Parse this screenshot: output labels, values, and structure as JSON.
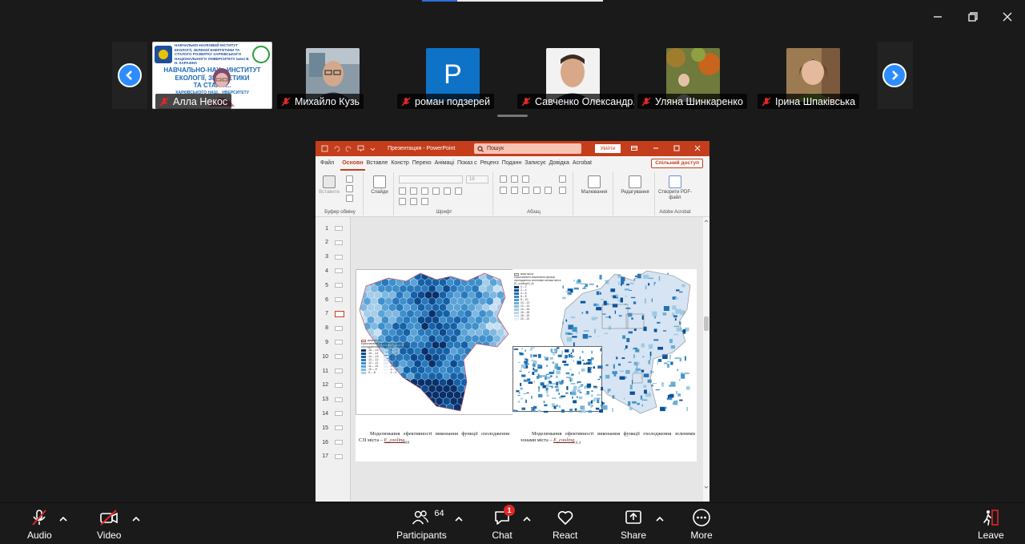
{
  "colors": {
    "accent": "#2d8cff",
    "powerpoint": "#c43e1c",
    "mute": "#e02828",
    "background": "#1a1a1a"
  },
  "participants": [
    {
      "name": "Алла Некос",
      "muted": true,
      "video": "poster"
    },
    {
      "name": "Михайло Кузь",
      "muted": true,
      "video": "photo"
    },
    {
      "name": "роман подзерей",
      "muted": true,
      "video": "letter",
      "letter": "P"
    },
    {
      "name": "Савченко Олександр...",
      "muted": true,
      "video": "photo"
    },
    {
      "name": "Уляна Шинкаренко",
      "muted": true,
      "video": "photo"
    },
    {
      "name": "Ірина Шпаківська",
      "muted": true,
      "video": "photo"
    }
  ],
  "poster": {
    "header": "НАВЧАЛЬНО-НАУКОВИЙ ІНСТИТУТ ЕКОЛОГІЇ, ЗЕЛЕНОЇ ЕНЕРГЕТИКИ ТА СТАЛОГО РОЗВИТКУ ХАРКІВСЬКОГО НАЦІОНАЛЬНОГО УНІВЕРСИТЕТУ імені В. Н. КАРАЗІНА",
    "big_1": "НАВЧАЛЬНО-НАУ... ИНСТИТУТ",
    "big_2": "ЕКОЛОГІЇ, ЗЕЛ... ЕТИКИ",
    "big_3": "ТА СТАЛО...",
    "big_4": "ХАРКІВСЬКОГО НАЦІ... ИВЕРСИТЕТУ"
  },
  "powerpoint": {
    "title": "Презентация  -  PowerPoint",
    "search_placeholder": "Пошук",
    "signin": "Увійти",
    "tabs": [
      "Файл",
      "Основн",
      "Вставле",
      "Констр",
      "Перехо",
      "Анімаці",
      "Показ с",
      "Реценз",
      "Поданн",
      "Записує",
      "Довідка",
      "Acrobat"
    ],
    "active_tab": "Основн",
    "share_label": "Спільний доступ",
    "ribbon": {
      "paste": "Вставити",
      "clipboard": "Буфер обміну",
      "slides": "Слайди",
      "font": "Шрифт",
      "font_size": "18",
      "paragraph": "Абзац",
      "drawing": "Малювання",
      "editing": "Редагування",
      "create_pdf": "Створити PDF-файл",
      "acrobat": "Adobe Acrobat"
    },
    "slide_numbers": [
      "1",
      "2",
      "3",
      "4",
      "5",
      "6",
      "7",
      "8",
      "9",
      "10",
      "11",
      "12",
      "13",
      "14",
      "15",
      "16",
      "17"
    ],
    "selected_slide": "7",
    "slide": {
      "caption_left_main": "Моделювання ефективності виконання функції охолодження СЗІ міста – ",
      "caption_left_var": "E_cooling",
      "caption_left_sub": "ВЗІ",
      "caption_right_main": "Моделювання ефективності виконання функції охолодження зеленими зонами міста – ",
      "caption_right_var": "E_cooling",
      "caption_right_sub": "GI_d",
      "legend_left_title": "межі міста",
      "legend_left_sub": "Ефективність виконання функції охолодження СЗІ міста (E_coolingВЗІ)",
      "legend_left_items": [
        "-16 – -15",
        "-15 – -14",
        "-14 – -13",
        "-13 – -12",
        "-12 – -11",
        "-11 – -10",
        "-10 – -9",
        "-9 – -8"
      ],
      "legend_left_items2": [
        "-8 – -7",
        "-7 – -6",
        "-6 – -5",
        "-5 – -4",
        "-4 – -3",
        "-3 – -2",
        "-2 – -1",
        "-1 – 0"
      ],
      "legend_right_title": "межі міста",
      "legend_right_sub": "Ефективність виконання функції охолодження зеленими зонами міста (E_coolingGI_d)",
      "legend_right_items": [
        "0 – 2",
        "2 – 4",
        "4 – 6",
        "6 – 8",
        "8 – 10",
        "10 – 12",
        "12 – 14",
        "14 – 16",
        "16 – 18",
        "18 – 20",
        "20 – 22"
      ]
    }
  },
  "toolbar": {
    "audio": "Audio",
    "video": "Video",
    "participants": "Participants",
    "participants_count": "64",
    "chat": "Chat",
    "chat_badge": "1",
    "react": "React",
    "share": "Share",
    "more": "More",
    "leave": "Leave"
  }
}
